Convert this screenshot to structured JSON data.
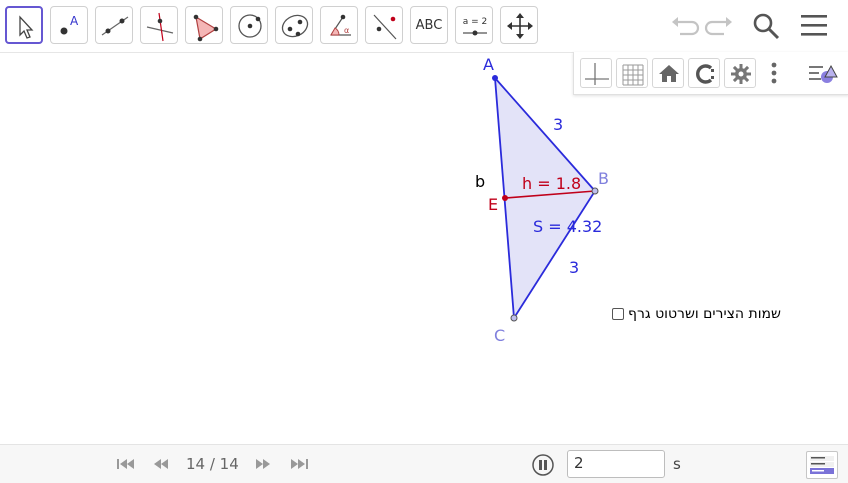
{
  "toolbar": {
    "text_tool_label": "ABC",
    "slider_tool_label": "a = 2",
    "point_tool_label": "A"
  },
  "figure": {
    "label_A": "A",
    "label_B": "B",
    "label_C": "C",
    "label_E": "E",
    "label_b": "b",
    "side_AB": "3",
    "side_BC": "3",
    "height": "h = 1.8",
    "area": "S = 4.32",
    "colors": {
      "triangle": "#2b2bdb",
      "fill": "#e3e3f8",
      "height": "#c0001a",
      "muted_label": "#8080dd"
    }
  },
  "checkbox": {
    "label": "שמות הצירים ושרטוט גרף",
    "checked": false
  },
  "bottom": {
    "page": "14 / 14",
    "speed_value": "2",
    "speed_unit": "s"
  },
  "icons": [
    "move-tool-icon",
    "point-tool-icon",
    "line-tool-icon",
    "perpendicular-tool-icon",
    "polygon-tool-icon",
    "circle-tool-icon",
    "conic-tool-icon",
    "angle-tool-icon",
    "reflect-tool-icon",
    "text-tool-icon",
    "slider-tool-icon",
    "move-view-tool-icon",
    "undo-icon",
    "redo-icon",
    "search-icon",
    "menu-icon",
    "axes-icon",
    "grid-icon",
    "home-icon",
    "point-capture-icon",
    "settings-icon",
    "more-icon",
    "algebra-toggle-icon",
    "first-icon",
    "previous-icon",
    "next-icon",
    "last-icon",
    "pause-icon",
    "algebra-input-icon"
  ]
}
